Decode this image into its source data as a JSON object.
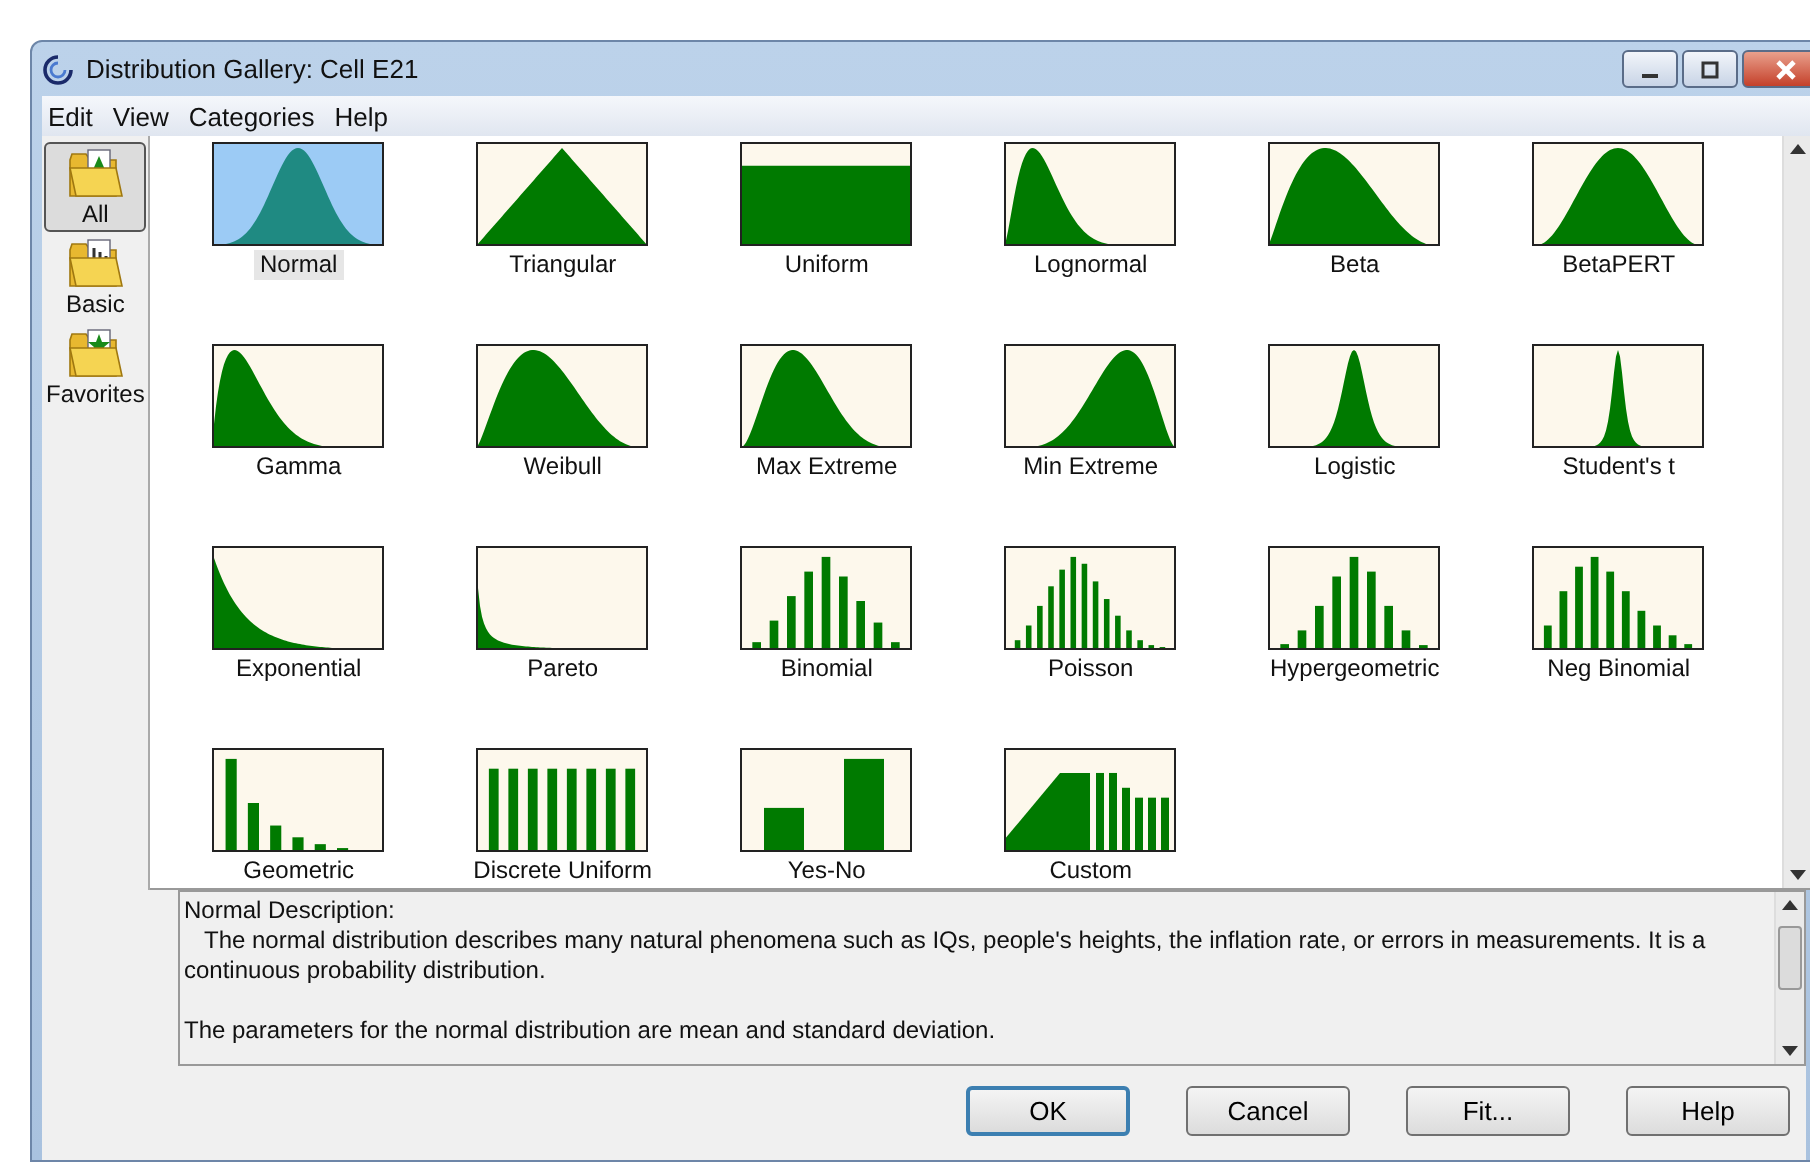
{
  "window": {
    "title": "Distribution Gallery: Cell E21"
  },
  "menu": [
    "Edit",
    "View",
    "Categories",
    "Help"
  ],
  "categories": [
    {
      "label": "All",
      "selected": true
    },
    {
      "label": "Basic",
      "selected": false
    },
    {
      "label": "Favorites",
      "selected": false
    }
  ],
  "distributions": [
    {
      "label": "Normal",
      "kind": "normal",
      "selected": true
    },
    {
      "label": "Triangular",
      "kind": "triangular",
      "selected": false
    },
    {
      "label": "Uniform",
      "kind": "uniform",
      "selected": false
    },
    {
      "label": "Lognormal",
      "kind": "lognormal",
      "selected": false
    },
    {
      "label": "Beta",
      "kind": "beta",
      "selected": false
    },
    {
      "label": "BetaPERT",
      "kind": "pert",
      "selected": false
    },
    {
      "label": "Gamma",
      "kind": "gamma",
      "selected": false
    },
    {
      "label": "Weibull",
      "kind": "weibull",
      "selected": false
    },
    {
      "label": "Max Extreme",
      "kind": "maxext",
      "selected": false
    },
    {
      "label": "Min Extreme",
      "kind": "minext",
      "selected": false
    },
    {
      "label": "Logistic",
      "kind": "logistic",
      "selected": false
    },
    {
      "label": "Student's t",
      "kind": "studentt",
      "selected": false
    },
    {
      "label": "Exponential",
      "kind": "exponential",
      "selected": false
    },
    {
      "label": "Pareto",
      "kind": "pareto",
      "selected": false
    },
    {
      "label": "Binomial",
      "kind": "binomial",
      "selected": false
    },
    {
      "label": "Poisson",
      "kind": "poisson",
      "selected": false
    },
    {
      "label": "Hypergeometric",
      "kind": "hypergeometric",
      "selected": false
    },
    {
      "label": "Neg Binomial",
      "kind": "negbinomial",
      "selected": false
    },
    {
      "label": "Geometric",
      "kind": "geometric",
      "selected": false
    },
    {
      "label": "Discrete Uniform",
      "kind": "discreteuniform",
      "selected": false
    },
    {
      "label": "Yes-No",
      "kind": "yesno",
      "selected": false
    },
    {
      "label": "Custom",
      "kind": "custom",
      "selected": false
    }
  ],
  "description": {
    "title": "Normal Description:",
    "paragraphs": [
      "The normal distribution describes many natural phenomena such as IQs, people's heights, the inflation rate, or errors in measurements. It is a continuous probability distribution.",
      "The parameters for the normal distribution are mean and standard deviation."
    ]
  },
  "buttons": [
    {
      "label": "OK",
      "default": true
    },
    {
      "label": "Cancel",
      "default": false
    },
    {
      "label": "Fit...",
      "default": false
    },
    {
      "label": "Help",
      "default": false
    }
  ]
}
